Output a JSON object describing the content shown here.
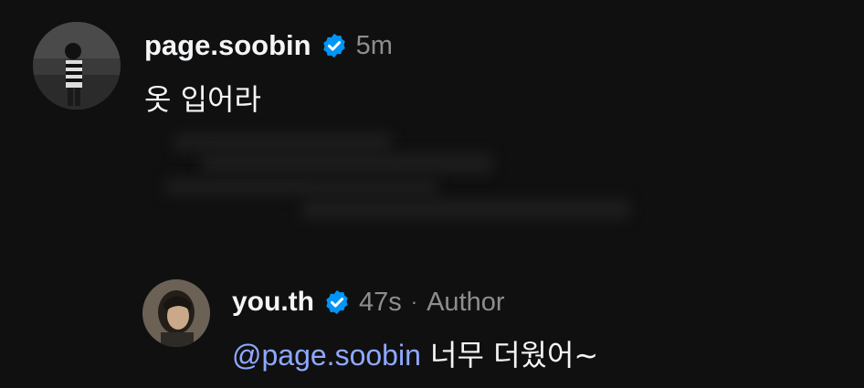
{
  "thread": {
    "comment": {
      "username": "page.soobin",
      "time": "5m",
      "text": "옷 입어라",
      "verified_icon": "verified-badge-icon"
    },
    "reply": {
      "username": "you.th",
      "time": "47s",
      "separator": "·",
      "role": "Author",
      "mention": "@page.soobin",
      "text": " 너무 더웠어~",
      "verified_icon": "verified-badge-icon"
    }
  },
  "colors": {
    "background": "#101010",
    "text": "#f3f5f7",
    "muted": "#8e8e8e",
    "mention": "#8fa8ff",
    "verified": "#0095f6"
  }
}
